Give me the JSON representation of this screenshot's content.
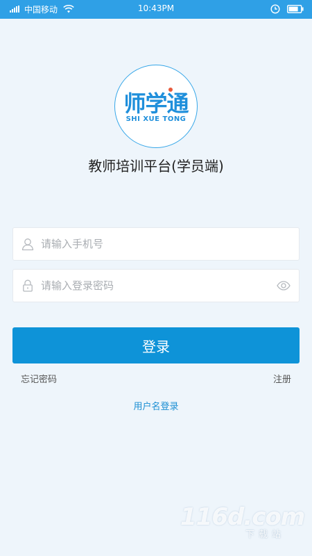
{
  "status_bar": {
    "carrier": "中国移动",
    "time": "10:43PM"
  },
  "logo": {
    "chinese": "师学通",
    "english": "SHI XUE TONG"
  },
  "app_title": "教师培训平台(学员端)",
  "form": {
    "phone_placeholder": "请输入手机号",
    "password_placeholder": "请输入登录密码",
    "login_label": "登录",
    "forgot_label": "忘记密码",
    "register_label": "注册",
    "username_login_label": "用户名登录"
  },
  "watermark": {
    "brand": "116d.com",
    "sub": "下载站"
  },
  "colors": {
    "status_bar": "#2fa0e6",
    "accent": "#0e93d8",
    "background": "#eef5fb",
    "link": "#1b8ed3"
  },
  "icons": [
    "signal-icon",
    "wifi-icon",
    "clock-icon",
    "battery-icon",
    "user-icon",
    "lock-icon",
    "eye-icon"
  ]
}
